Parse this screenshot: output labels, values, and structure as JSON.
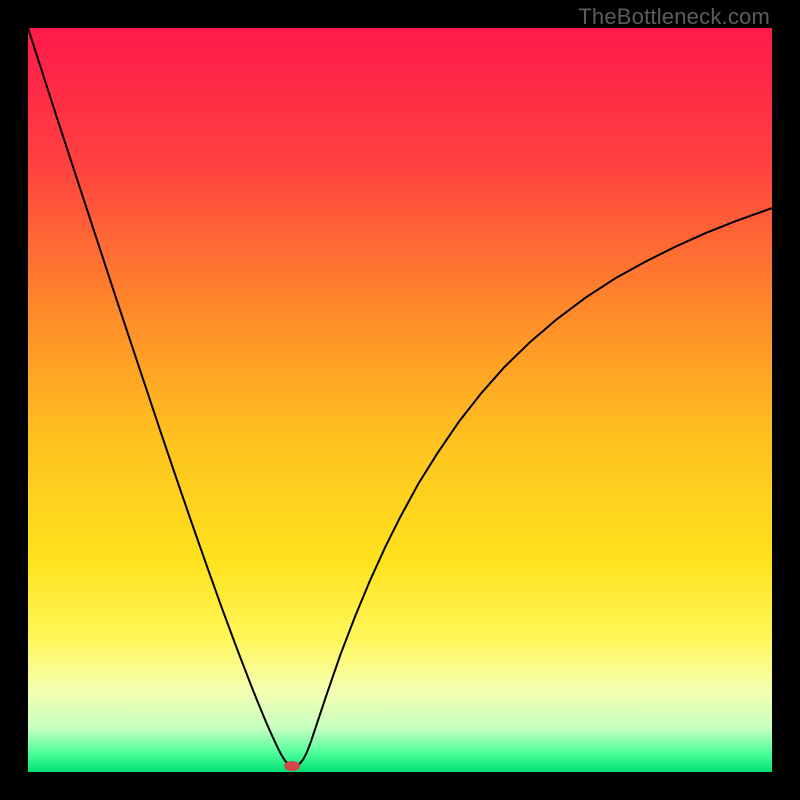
{
  "watermark": "TheBottleneck.com",
  "chart_data": {
    "type": "line",
    "title": "",
    "xlabel": "",
    "ylabel": "",
    "xlim": [
      0,
      100
    ],
    "ylim": [
      0,
      100
    ],
    "grid": false,
    "legend": false,
    "background_gradient": [
      {
        "stop": 0.0,
        "color": "#ff1a4b"
      },
      {
        "stop": 0.18,
        "color": "#ff4040"
      },
      {
        "stop": 0.38,
        "color": "#ff8a2a"
      },
      {
        "stop": 0.55,
        "color": "#ffc11f"
      },
      {
        "stop": 0.72,
        "color": "#ffe31e"
      },
      {
        "stop": 0.82,
        "color": "#fff75a"
      },
      {
        "stop": 0.89,
        "color": "#f6ffb0"
      },
      {
        "stop": 0.94,
        "color": "#c9ffc0"
      },
      {
        "stop": 0.975,
        "color": "#4dff9a"
      },
      {
        "stop": 1.0,
        "color": "#00e072"
      }
    ],
    "series": [
      {
        "name": "bottleneck-curve",
        "color": "#000000",
        "stroke_width": 2,
        "x": [
          0.0,
          2.0,
          4.0,
          6.0,
          8.0,
          10.0,
          12.0,
          14.0,
          16.0,
          18.0,
          20.0,
          22.0,
          24.0,
          26.0,
          28.0,
          30.0,
          31.0,
          32.0,
          32.8,
          33.5,
          34.0,
          34.5,
          35.0,
          35.2,
          35.5,
          36.0,
          36.5,
          37.0,
          37.5,
          38.0,
          39.0,
          40.0,
          42.0,
          44.0,
          46.0,
          48.0,
          50.0,
          52.5,
          55.0,
          58.0,
          61.0,
          64.0,
          67.5,
          71.0,
          75.0,
          79.0,
          83.0,
          87.0,
          91.0,
          95.0,
          100.0
        ],
        "y": [
          100.0,
          93.8,
          87.6,
          81.5,
          75.4,
          69.3,
          63.2,
          57.2,
          51.2,
          45.2,
          39.3,
          33.5,
          27.8,
          22.2,
          16.8,
          11.6,
          9.1,
          6.7,
          4.9,
          3.4,
          2.4,
          1.6,
          1.0,
          0.85,
          0.8,
          0.85,
          1.1,
          1.7,
          2.7,
          4.0,
          7.0,
          10.0,
          15.8,
          21.0,
          25.8,
          30.2,
          34.2,
          38.8,
          42.8,
          47.2,
          51.0,
          54.4,
          57.8,
          60.8,
          63.8,
          66.4,
          68.6,
          70.6,
          72.4,
          74.0,
          75.8
        ]
      }
    ],
    "marker": {
      "name": "optimal-point",
      "x": 35.5,
      "y": 0.8,
      "color": "#d04a4a",
      "rx": 8,
      "ry": 5
    }
  }
}
